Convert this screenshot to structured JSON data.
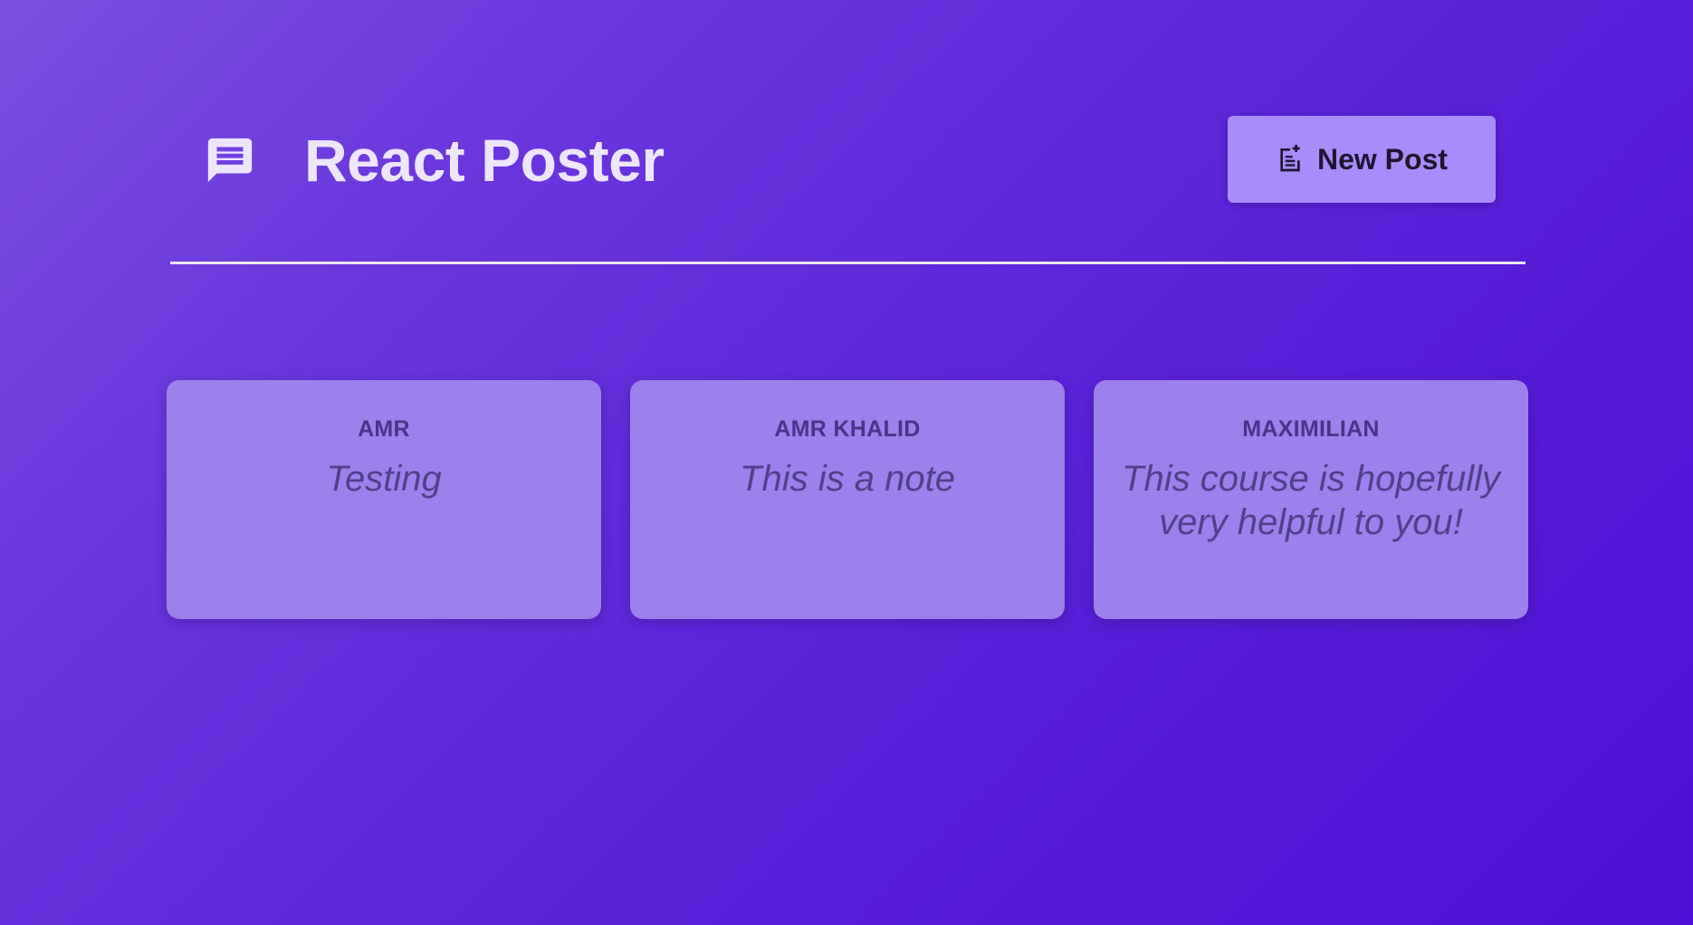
{
  "header": {
    "title": "React Poster",
    "logo_icon": "chat-bubble-icon",
    "new_post_label": "New Post",
    "new_post_icon": "note-add-icon"
  },
  "colors": {
    "background_start": "#7c4fe0",
    "background_end": "#4f0fd4",
    "card": "#9c80ec",
    "button": "#a98cfc",
    "title": "#ede4ff"
  },
  "posts": [
    {
      "author": "AMR",
      "body": "Testing"
    },
    {
      "author": "AMR KHALID",
      "body": "This is a note"
    },
    {
      "author": "MAXIMILIAN",
      "body": "This course is hopefully very helpful to you!"
    }
  ]
}
